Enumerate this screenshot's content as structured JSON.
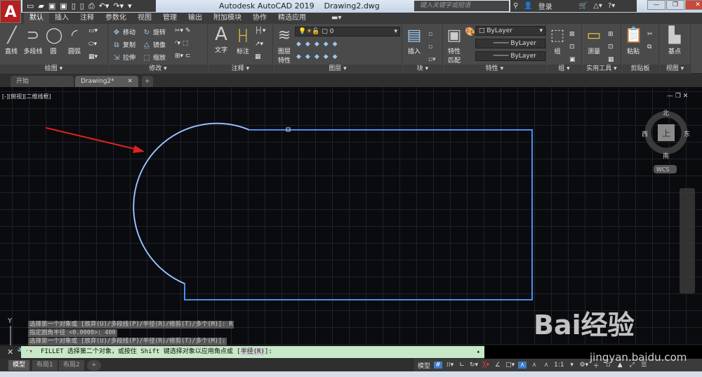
{
  "titlebar": {
    "app_title": "Autodesk AutoCAD 2019",
    "file": "Drawing2.dwg",
    "search_placeholder": "键入关键字或短语",
    "login": "登录",
    "app_logo": "A"
  },
  "ribbon_tabs": [
    "默认",
    "插入",
    "注释",
    "参数化",
    "视图",
    "管理",
    "输出",
    "附加模块",
    "协作",
    "精选应用"
  ],
  "panels": {
    "draw": {
      "title": "绘图",
      "tools": [
        "直线",
        "多段线",
        "圆",
        "圆弧"
      ]
    },
    "modify": {
      "title": "修改",
      "tools": [
        "移动",
        "旋转",
        "复制",
        "镜像",
        "拉伸",
        "缩放"
      ]
    },
    "annotate": {
      "title": "注释",
      "tools": [
        "文字",
        "标注"
      ]
    },
    "layers": {
      "title": "图层",
      "tools": [
        "图层特性"
      ],
      "layer_value": "0"
    },
    "block": {
      "title": "块",
      "tools": [
        "插入"
      ]
    },
    "properties": {
      "title": "特性",
      "tools": [
        "特性匹配"
      ],
      "color": "ByLayer",
      "linetype": "ByLayer",
      "lineweight": "ByLayer"
    },
    "groups": {
      "title": "组",
      "tools": [
        "组"
      ]
    },
    "utilities": {
      "title": "实用工具",
      "tools": [
        "测量"
      ]
    },
    "clipboard": {
      "title": "剪贴板",
      "tools": [
        "粘贴"
      ]
    },
    "view": {
      "title": "视图",
      "tools": [
        "基点"
      ]
    }
  },
  "doc_tabs": [
    "开始",
    "Drawing2*"
  ],
  "viewport_label": "[-][俯视][二维线框]",
  "viewcube": {
    "north": "北",
    "south": "南",
    "east": "东",
    "west": "西",
    "top": "上",
    "wcs": "WCS"
  },
  "command_history": [
    "选择第一个对象或 [放弃(U)/多段线(P)/半径(R)/修剪(T)/多个(M)]: R",
    "指定圆角半径 <0.0000>: 400",
    "选择第一个对象或 [放弃(U)/多段线(P)/半径(R)/修剪(T)/多个(M)]:"
  ],
  "command_line": {
    "prefix": "FILLET 选择第二个对象，或按住 Shift 键选择对象以应用角点或 [",
    "option": "半径(R)",
    "suffix": "]:"
  },
  "layout_tabs": [
    "模型",
    "布局1",
    "布局2"
  ],
  "status": {
    "model": "模型",
    "scale": "1:1"
  },
  "watermark": {
    "brand": "Bai经验",
    "url": "jingyan.baidu.com"
  },
  "colors": {
    "entity": "#4a8ef0",
    "arrow": "#e02020",
    "cmd_bg": "#c8e8c8"
  }
}
